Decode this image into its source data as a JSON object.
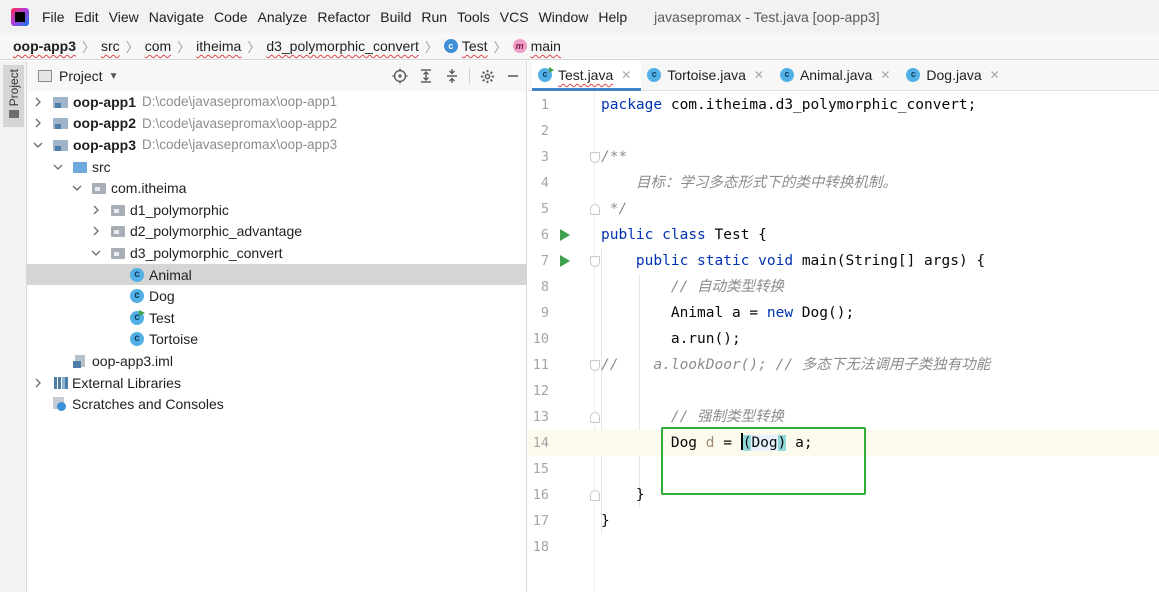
{
  "menu": {
    "items": [
      "File",
      "Edit",
      "View",
      "Navigate",
      "Code",
      "Analyze",
      "Refactor",
      "Build",
      "Run",
      "Tools",
      "VCS",
      "Window",
      "Help"
    ],
    "window_title": "javasepromax - Test.java [oop-app3]"
  },
  "breadcrumb": {
    "items": [
      "oop-app3",
      "src",
      "com",
      "itheima",
      "d3_polymorphic_convert",
      "Test",
      "main"
    ]
  },
  "side_stripe": {
    "project_tab": "Project"
  },
  "project_panel": {
    "title": "Project",
    "tree": [
      {
        "label": "oop-app1",
        "path": "D:\\code\\javasepromax\\oop-app1"
      },
      {
        "label": "oop-app2",
        "path": "D:\\code\\javasepromax\\oop-app2"
      },
      {
        "label": "oop-app3",
        "path": "D:\\code\\javasepromax\\oop-app3"
      },
      {
        "label": "src"
      },
      {
        "label": "com.itheima"
      },
      {
        "label": "d1_polymorphic"
      },
      {
        "label": "d2_polymorphic_advantage"
      },
      {
        "label": "d3_polymorphic_convert"
      },
      {
        "label": "Animal"
      },
      {
        "label": "Dog"
      },
      {
        "label": "Test"
      },
      {
        "label": "Tortoise"
      },
      {
        "label": "oop-app3.iml"
      },
      {
        "label": "External Libraries"
      },
      {
        "label": "Scratches and Consoles"
      }
    ]
  },
  "editor": {
    "tabs": [
      "Test.java",
      "Tortoise.java",
      "Animal.java",
      "Dog.java"
    ],
    "line_numbers": [
      "1",
      "2",
      "3",
      "4",
      "5",
      "6",
      "7",
      "8",
      "9",
      "10",
      "11",
      "12",
      "13",
      "14",
      "15",
      "16",
      "17",
      "18"
    ],
    "code": {
      "l1_kw": "package",
      "l1_rest": " com.itheima.d3_polymorphic_convert;",
      "l3": "/**",
      "l4": "    目标：学习多态形式下的类中转换机制。",
      "l5": " */",
      "l6_kw1": "public",
      "l6_kw2": "class",
      "l6_rest": " Test {",
      "l7_kw1": "public",
      "l7_kw2": "static",
      "l7_kw3": "void",
      "l7_rest": " main(String[] args) {",
      "l8": "// 自动类型转换",
      "l9_a": "Animal a = ",
      "l9_kw": "new",
      "l9_b": " Dog();",
      "l10": "a.run();",
      "l11_a": "//",
      "l11_b": "    a.lookDoor(); // 多态下无法调用子类独有功能",
      "l13": "// 强制类型转换",
      "l14_a": "Dog ",
      "l14_var": "d",
      "l14_b": " = ",
      "l14_paren": "(",
      "l14_cast": "Dog",
      "l14_paren2": ")",
      "l14_c": " a;",
      "l16": "}",
      "l17": "}"
    }
  },
  "colors": {
    "keyword": "#0033b3",
    "comment": "#8c8c8c",
    "run_gutter": "#3ea04a",
    "highlight_box": "#2fad36",
    "active_tab_underline": "#4083c9"
  }
}
